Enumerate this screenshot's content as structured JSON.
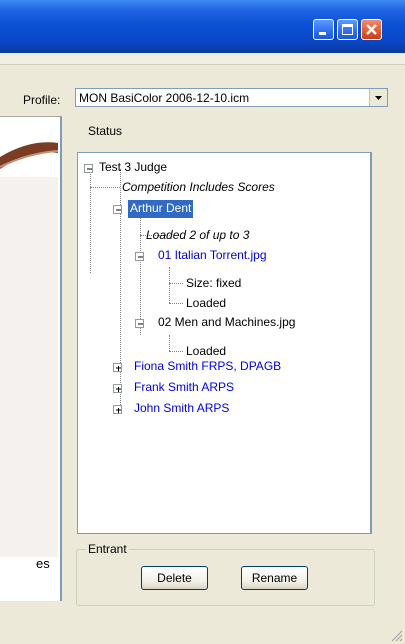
{
  "titlebar": {
    "minimize_icon": "minimize-icon",
    "maximize_icon": "maximize-icon",
    "close_icon": "close-icon"
  },
  "preview": {
    "partial_text": "es"
  },
  "profile": {
    "label": "Profile:",
    "selected": "MON BasiColor 2006-12-10.icm"
  },
  "status": {
    "label": "Status"
  },
  "tree": {
    "root": "Test 3 Judge",
    "competition_note": "Competition Includes Scores",
    "entrant_selected": "Arthur Dent",
    "loaded_count": "Loaded 2 of up to 3",
    "image1": "01 Italian Torrent.jpg",
    "image1_size": "Size: fixed",
    "image1_loaded": "Loaded",
    "image2": "02 Men and Machines.jpg",
    "image2_loaded": "Loaded",
    "entrant2": "Fiona Smith FRPS, DPAGB",
    "entrant3": "Frank Smith ARPS",
    "entrant4": "John Smith ARPS"
  },
  "entrant_group": {
    "label": "Entrant",
    "delete_label": "Delete",
    "rename_label": "Rename"
  },
  "colors": {
    "titlebar": "#0a4fd4",
    "selection": "#316ac5",
    "link_blue": "#0000e8",
    "close_red": "#e05a32"
  }
}
